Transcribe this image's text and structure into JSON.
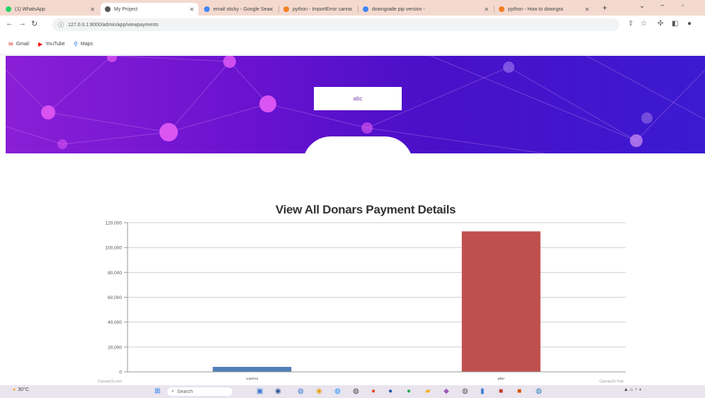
{
  "browser": {
    "tabs": [
      {
        "title": "(1) WhatsApp",
        "color": "#25d366"
      },
      {
        "title": "My Project",
        "color": "#555555"
      },
      {
        "title": "email sticky - Google Sea",
        "color": "#4285f4"
      },
      {
        "title": "python - ImportError cann",
        "color": "#f48024"
      },
      {
        "title": "downgrade pip version - ",
        "color": "#4285f4"
      },
      {
        "title": "python - How to downgra",
        "color": "#f48024"
      }
    ],
    "url": "127.0.0.1:8000/admin/app/viewpayments",
    "bookmarks": [
      {
        "label": "Gmail",
        "icon": "mail-icon",
        "color": "#d93025"
      },
      {
        "label": "YouTube",
        "icon": "youtube-icon",
        "color": "#ff0000"
      },
      {
        "label": "Maps",
        "icon": "maps-icon",
        "color": "#1a73e8"
      }
    ]
  },
  "hero": {
    "box_text": "abc"
  },
  "chart_data": {
    "type": "bar",
    "title": "View All Donars Payment Details",
    "categories": [
      "vamsi",
      "abc"
    ],
    "values": [
      4000,
      113000
    ],
    "colors": [
      "#4f7fb8",
      "#c0504d"
    ],
    "ylim": [
      0,
      120000
    ],
    "yticks": [
      "0",
      "20,000",
      "40,000",
      "60,000",
      "80,000",
      "100,000",
      "120,000"
    ],
    "grid": true,
    "xlabel": "",
    "ylabel": ""
  },
  "footer": {
    "left_credit": "CanvasJS.com",
    "right_credit": "CanvasJS Trial"
  },
  "taskbar": {
    "weather": "30°C",
    "search_placeholder": "Search"
  }
}
